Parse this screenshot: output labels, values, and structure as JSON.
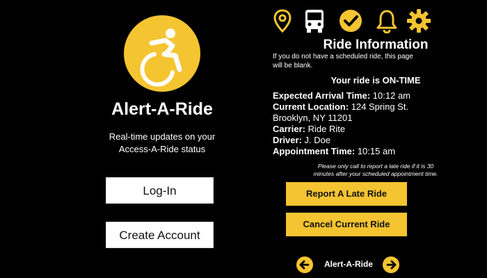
{
  "left": {
    "app_title": "Alert-A-Ride",
    "subtitle_line1": "Real-time updates on your",
    "subtitle_line2": "Access-A-Ride status",
    "login_label": "Log-In",
    "create_account_label": "Create Account",
    "logo_icon": "accessibility-wheelchair-icon"
  },
  "right": {
    "icons": [
      "location-pin-icon",
      "bus-icon",
      "checkmark-icon",
      "bell-icon",
      "gear-icon"
    ],
    "title": "Ride Information",
    "note_line1": "If you do not have a scheduled ride, this page",
    "note_line2": "will be blank.",
    "status": "Your ride is ON-TIME",
    "details": {
      "arrival_label": "Expected Arrival Time:",
      "arrival_value": "10:12 am",
      "location_label": "Current Location:",
      "location_value_line1": "124 Spring St.",
      "location_value_line2": "Brooklyn, NY 11201",
      "carrier_label": "Carrier:",
      "carrier_value": "Ride Rite",
      "driver_label": "Driver:",
      "driver_value": "J. Doe",
      "appointment_label": "Appointment Time:",
      "appointment_value": "10:15 am"
    },
    "call_note_line1": "Please only call to report a late ride if it is 30",
    "call_note_line2": "minutes after your scheduled appointment time.",
    "report_label": "Report A Late Ride",
    "cancel_label": "Cancel Current Ride",
    "footer_label": "Alert-A-Ride"
  },
  "colors": {
    "background": "#000000",
    "accent": "#f5c431",
    "button_white": "#ffffff",
    "text": "#ffffff"
  }
}
